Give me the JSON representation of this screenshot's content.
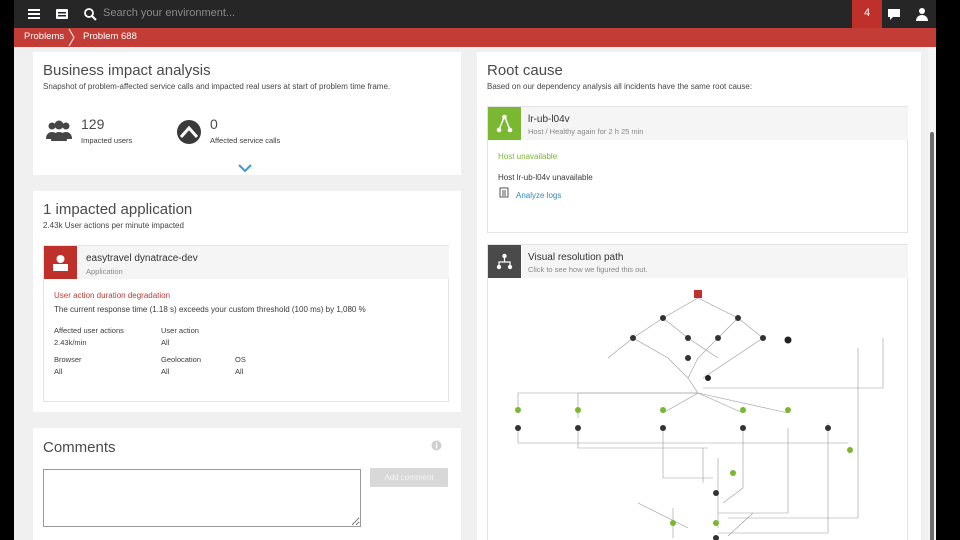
{
  "topbar": {
    "search_placeholder": "Search your environment...",
    "notification_count": "4"
  },
  "breadcrumb": {
    "items": [
      "Problems",
      "Problem 688"
    ]
  },
  "business_impact": {
    "title": "Business impact analysis",
    "subtitle": "Snapshot of problem-affected service calls and impacted real users at start of problem time frame.",
    "impacted_users_value": "129",
    "impacted_users_label": "Impacted users",
    "affected_calls_value": "0",
    "affected_calls_label": "Affected service calls"
  },
  "impacted_app": {
    "title": "1 impacted application",
    "subtitle": "2.43k User actions per minute impacted",
    "app_name": "easytravel dynatrace-dev",
    "app_type": "Application",
    "alert_title": "User action duration degradation",
    "alert_text": "The current response time (1.18 s) exceeds your custom threshold (100 ms) by 1,080 %",
    "fields": [
      {
        "label": "Affected user actions",
        "value": "2.43k/min"
      },
      {
        "label": "User action",
        "value": "All"
      },
      {
        "label": "Browser",
        "value": "All"
      },
      {
        "label": "Geolocation",
        "value": "All"
      },
      {
        "label": "OS",
        "value": "All"
      }
    ]
  },
  "comments": {
    "title": "Comments",
    "button_label": "Add comment"
  },
  "root_cause": {
    "title": "Root cause",
    "subtitle": "Based on our dependency analysis all incidents have the same root cause:",
    "host_name": "lr-ub-l04v",
    "host_status": "Host / Healthy again for 2 h 25 min",
    "event_title": "Host unavailable",
    "event_text": "Host lr-ub-l04v unavailable",
    "analyze_logs": "Analyze logs"
  },
  "resolution": {
    "title": "Visual resolution path",
    "subtitle": "Click to see how we figured this out."
  },
  "colors": {
    "topbar": "#262626",
    "crumb": "#c33c36",
    "host_green": "#7ab832",
    "app_red": "#c0302b"
  }
}
